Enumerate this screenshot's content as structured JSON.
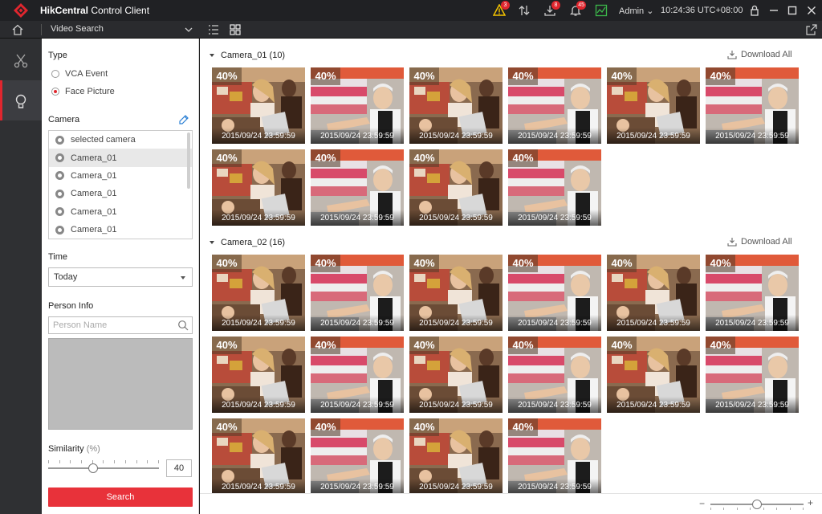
{
  "titlebar": {
    "app_name_bold": "HikCentral",
    "app_name_rest": " Control Client",
    "alerts": {
      "warning_count": "3",
      "download_count": "8",
      "notification_count": "45"
    },
    "user": "Admin",
    "clock": "10:24:36 UTC+08:00"
  },
  "modulebar": {
    "title": "Video Search"
  },
  "filters": {
    "type_label": "Type",
    "type_options": [
      "VCA Event",
      "Face Picture"
    ],
    "type_selected": "Face Picture",
    "camera_label": "Camera",
    "cameras": [
      "selected camera",
      "Camera_01",
      "Camera_01",
      "Camera_01",
      "Camera_01",
      "Camera_01"
    ],
    "time_label": "Time",
    "time_value": "Today",
    "person_label": "Person Info",
    "person_placeholder": "Person Name",
    "similarity_label": "Similarity",
    "similarity_unit": "(%)",
    "similarity_value": "40",
    "search_label": "Search"
  },
  "results": {
    "download_all": "Download All",
    "groups": [
      {
        "title": "Camera_01 (10)",
        "count": 10
      },
      {
        "title": "Camera_02 (16)",
        "count": 16
      }
    ],
    "thumb_similarity": "40%",
    "thumb_time": "2015/09/24 23:59:59"
  },
  "icons": {
    "logo": "hikcentral-logo",
    "warning": "warning-icon",
    "transfer": "transfer-icon",
    "download": "download-icon",
    "bell": "bell-icon",
    "monitor": "monitor-icon",
    "lock": "lock-icon",
    "minimize": "minimize-icon",
    "maximize": "maximize-icon",
    "close": "close-icon"
  },
  "colors": {
    "accent": "#e8323a",
    "titlebar": "#202124",
    "rail": "#2f3033"
  }
}
